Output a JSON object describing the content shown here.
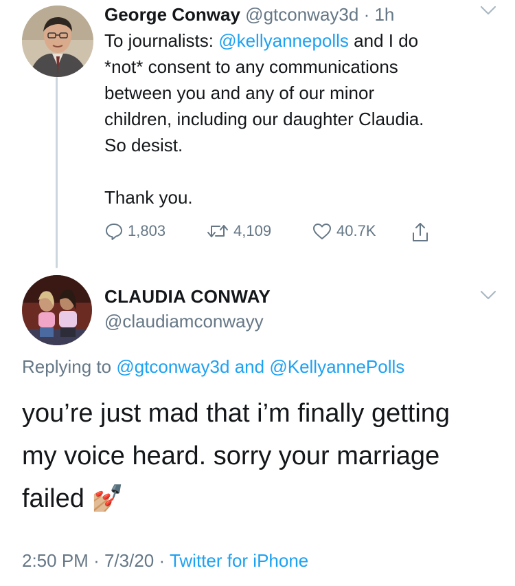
{
  "tweet1": {
    "display_name": "George Conway",
    "handle": "@gtconway3d",
    "separator": "·",
    "time": "1h",
    "text_line1_before": "To journalists:",
    "text_line1_mention": "@kellyannepolls",
    "text_line1_after": "and I do",
    "text_line2": "*not* consent to any communications",
    "text_line3": "between you and any of our minor",
    "text_line4": "children, including our daughter Claudia.",
    "text_line5": "So desist.",
    "text_line6": "Thank you.",
    "reply_count": "1,803",
    "retweet_count": "4,109",
    "like_count": "40.7K",
    "icons": {
      "reply": "reply-icon",
      "retweet": "retweet-icon",
      "like": "heart-icon",
      "share": "share-icon",
      "more": "chevron-down-icon"
    }
  },
  "tweet2": {
    "display_name": "CLAUDIA CONWAY",
    "handle": "@claudiamconwayy",
    "replying_prefix": "Replying to",
    "replying_mention1": "@gtconway3d",
    "replying_and": "and",
    "replying_mention2": "@KellyannePolls",
    "text_line1": "you’re just mad that i’m finally getting",
    "text_line2": "my voice heard. sorry your marriage",
    "text_line3": "failed",
    "emoji": "💅🏼",
    "time": "2:50 PM",
    "separator": "·",
    "date": "7/3/20",
    "source": "Twitter for iPhone"
  },
  "colors": {
    "link": "#1da1f2",
    "secondary_text": "#657786",
    "primary_text": "#14171a",
    "thread_line": "#ccd6dd"
  }
}
